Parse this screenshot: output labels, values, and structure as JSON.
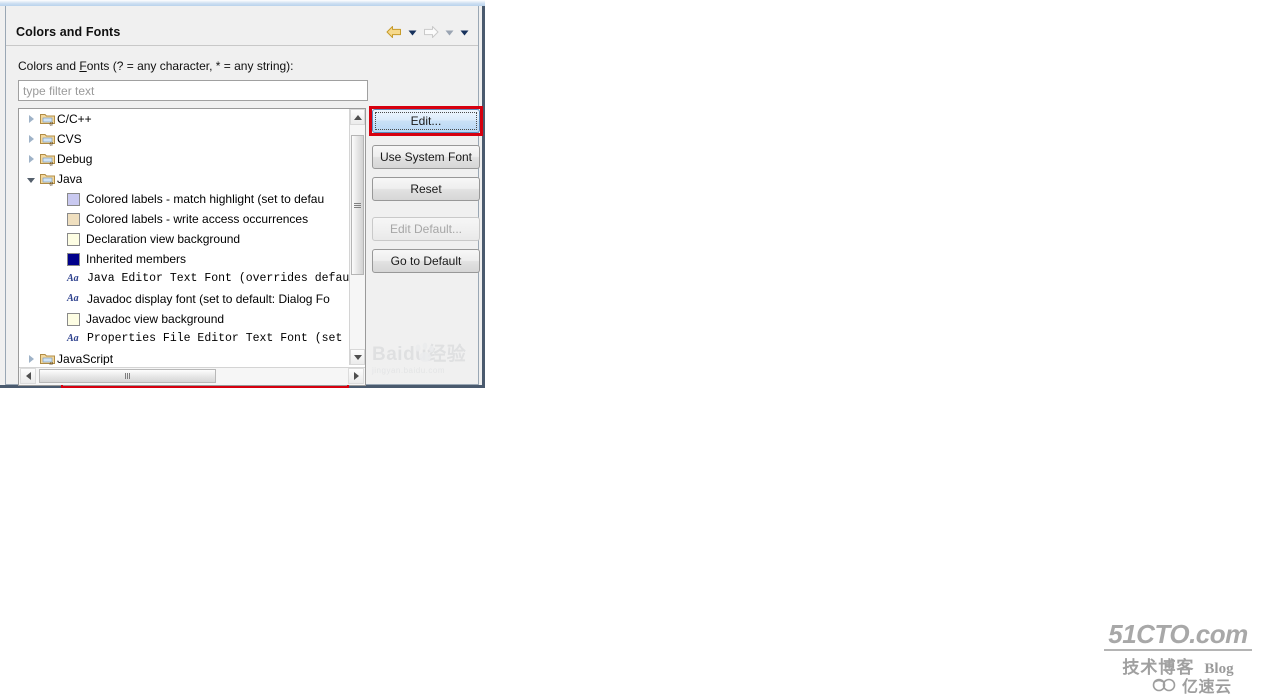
{
  "window": {
    "title": "Colors and Fonts",
    "nav": {
      "back_icon": "arrow-left-icon",
      "back_menu_icon": "chevron-down-icon",
      "forward_icon": "arrow-right-icon",
      "forward_menu_icon": "chevron-down-icon",
      "view_menu_icon": "chevron-down-icon"
    }
  },
  "page": {
    "filter_label": "Colors and Fonts (? = any character, * = any string):",
    "filter_label_parts": {
      "before": "Colors and ",
      "mnemonic": "F",
      "after": "onts (? = any character, * = any string):"
    },
    "filter_input": {
      "value": "",
      "placeholder": "type filter text"
    }
  },
  "tree": {
    "items": [
      {
        "label": "C/C++",
        "type": "folder",
        "indent": 0,
        "state": "collapsed",
        "icon": "folder-a-icon"
      },
      {
        "label": "CVS",
        "type": "folder",
        "indent": 0,
        "state": "collapsed",
        "icon": "folder-a-icon"
      },
      {
        "label": "Debug",
        "type": "folder",
        "indent": 0,
        "state": "collapsed",
        "icon": "folder-a-icon"
      },
      {
        "label": "Java",
        "type": "folder",
        "indent": 0,
        "state": "expanded",
        "icon": "folder-a-icon"
      },
      {
        "label": "Colored labels - match highlight (set to defau",
        "type": "color",
        "indent": 1,
        "swatch": "#c9c9f0",
        "icon": "color-swatch-icon"
      },
      {
        "label": "Colored labels - write access occurrences",
        "type": "color",
        "indent": 1,
        "swatch": "#efdfbf",
        "icon": "color-swatch-icon"
      },
      {
        "label": "Declaration view background",
        "type": "color",
        "indent": 1,
        "swatch": "#fdfde3",
        "icon": "color-swatch-icon"
      },
      {
        "label": "Inherited members",
        "type": "color",
        "indent": 1,
        "swatch": "#00008b",
        "icon": "color-swatch-icon"
      },
      {
        "label": "Java Editor Text Font (overrides defau",
        "type": "font",
        "indent": 1,
        "mono": true,
        "icon": "font-aa-icon",
        "highlighted": true
      },
      {
        "label": "Javadoc display font (set to default: Dialog Fo",
        "type": "font",
        "indent": 1,
        "mono": false,
        "icon": "font-aa-icon"
      },
      {
        "label": "Javadoc view background",
        "type": "color",
        "indent": 1,
        "swatch": "#fdfde3",
        "icon": "color-swatch-icon"
      },
      {
        "label": "Properties File Editor Text Font (set",
        "type": "font",
        "indent": 1,
        "mono": true,
        "icon": "font-aa-icon"
      },
      {
        "label": "JavaScript",
        "type": "folder",
        "indent": 0,
        "state": "collapsed",
        "icon": "folder-a-icon"
      }
    ],
    "vscrollbar": {
      "up_icon": "arrow-up-icon",
      "down_icon": "arrow-down-icon",
      "thumb_grip_icon": "grip-icon"
    },
    "hscrollbar": {
      "left_icon": "arrow-left-icon",
      "right_icon": "arrow-right-icon",
      "thumb_grip_icon": "grip-icon"
    }
  },
  "buttons": {
    "edit": {
      "label": "Edit...",
      "mnemonic": "E",
      "enabled": true,
      "focused": true
    },
    "use_system": {
      "label": "Use System Font",
      "mnemonic": "U",
      "enabled": true,
      "focused": false
    },
    "reset": {
      "label": "Reset",
      "mnemonic": "R",
      "enabled": true,
      "focused": false
    },
    "edit_default": {
      "label": "Edit Default...",
      "mnemonic": "i",
      "enabled": false,
      "focused": false
    },
    "go_to_default": {
      "label": "Go to Default",
      "mnemonic": "G",
      "enabled": true,
      "focused": false
    }
  },
  "annotations": {
    "highlight_color": "#d6000f",
    "highlighted_row_label": "Java Editor Text Font (overrides defau",
    "highlighted_button_label": "Edit..."
  },
  "watermarks": {
    "baidu": {
      "main": "Baidu",
      "cn": "经验",
      "sub": "jingyan.baidu.com",
      "icon": "paw-icon"
    },
    "cto": {
      "main": "51CTO.com",
      "cn": "技术博客",
      "blog": "Blog"
    },
    "yun": {
      "cn": "亿速云",
      "icon": "cloud-icon"
    }
  }
}
